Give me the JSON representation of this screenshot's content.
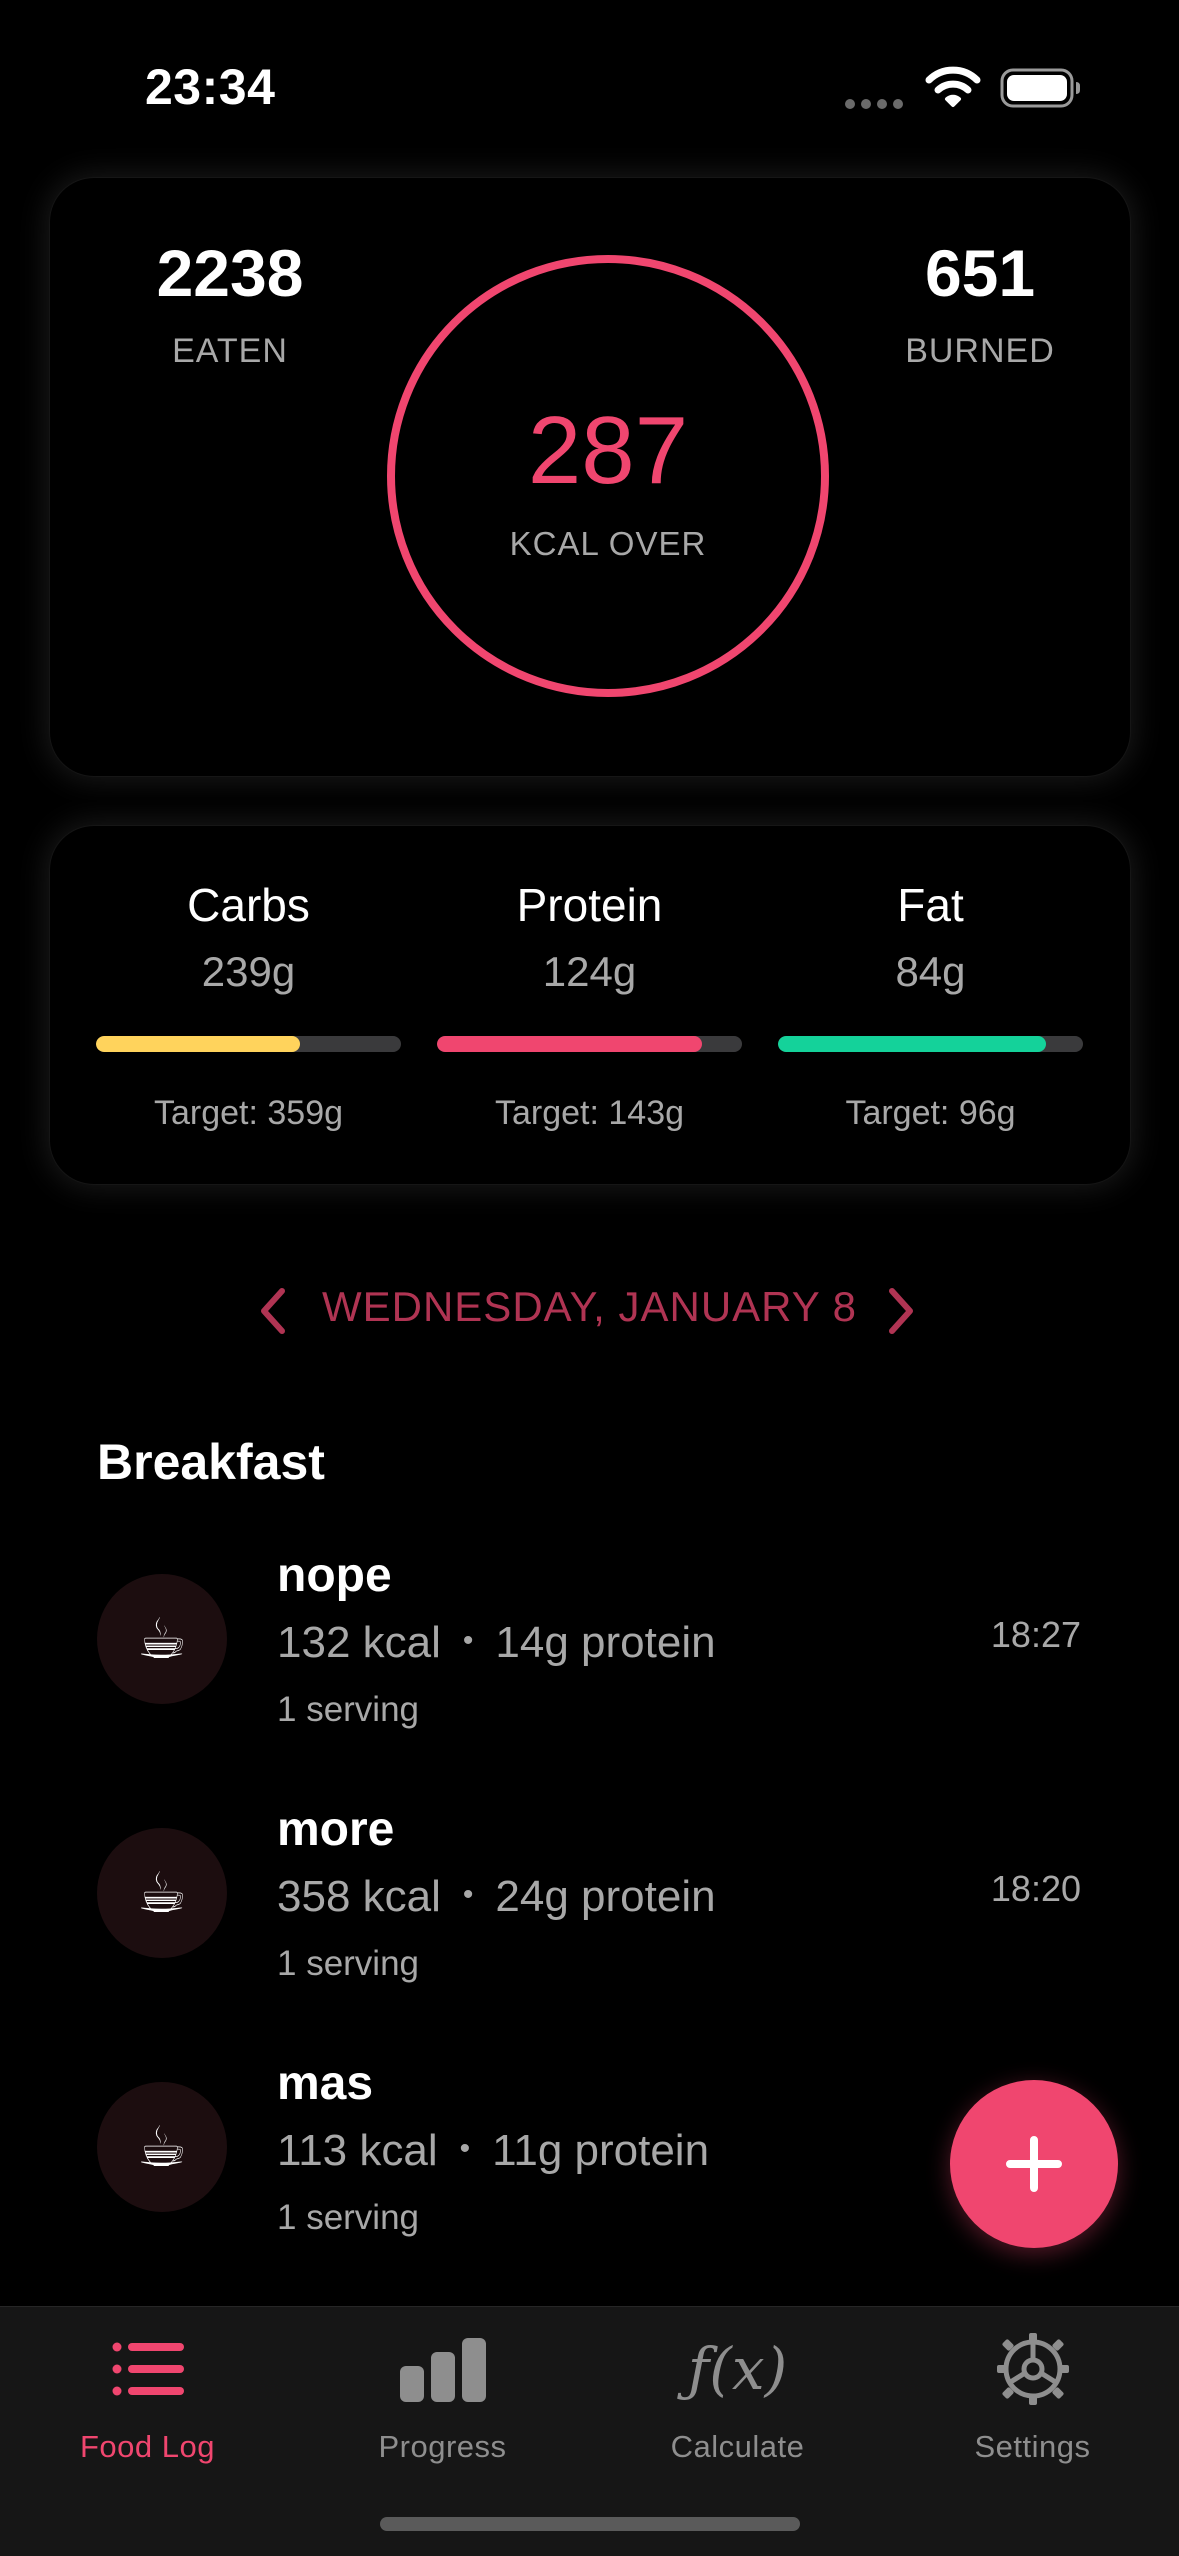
{
  "status_bar": {
    "time": "23:34"
  },
  "summary": {
    "eaten_value": "2238",
    "eaten_label": "EATEN",
    "burned_value": "651",
    "burned_label": "BURNED",
    "ring_value": "287",
    "ring_label": "KCAL OVER",
    "ring_color": "#f0466f"
  },
  "macros": [
    {
      "name": "Carbs",
      "amount": "239g",
      "target": "Target: 359g",
      "progress": 0.67,
      "color": "#ffd35c"
    },
    {
      "name": "Protein",
      "amount": "124g",
      "target": "Target: 143g",
      "progress": 0.87,
      "color": "#f0466f"
    },
    {
      "name": "Fat",
      "amount": "84g",
      "target": "Target: 96g",
      "progress": 0.88,
      "color": "#14d29a"
    }
  ],
  "date_nav": {
    "label": "WEDNESDAY, JANUARY 8"
  },
  "section": {
    "title": "Breakfast"
  },
  "entries": [
    {
      "icon": "☕",
      "name": "nope",
      "kcal": "132 kcal",
      "protein": "14g protein",
      "serving": "1 serving",
      "time": "18:27"
    },
    {
      "icon": "☕",
      "name": "more",
      "kcal": "358 kcal",
      "protein": "24g protein",
      "serving": "1 serving",
      "time": "18:20"
    },
    {
      "icon": "☕",
      "name": "mas",
      "kcal": "113 kcal",
      "protein": "11g protein",
      "serving": "1 serving",
      "time": ""
    }
  ],
  "tabs": [
    {
      "label": "Food Log",
      "icon": "list-icon",
      "active": true
    },
    {
      "label": "Progress",
      "icon": "bar-chart-icon",
      "active": false
    },
    {
      "label": "Calculate",
      "icon": "fx",
      "active": false
    },
    {
      "label": "Settings",
      "icon": "gear-icon",
      "active": false
    }
  ],
  "colors": {
    "accent": "#f0466f",
    "background": "#000000"
  }
}
